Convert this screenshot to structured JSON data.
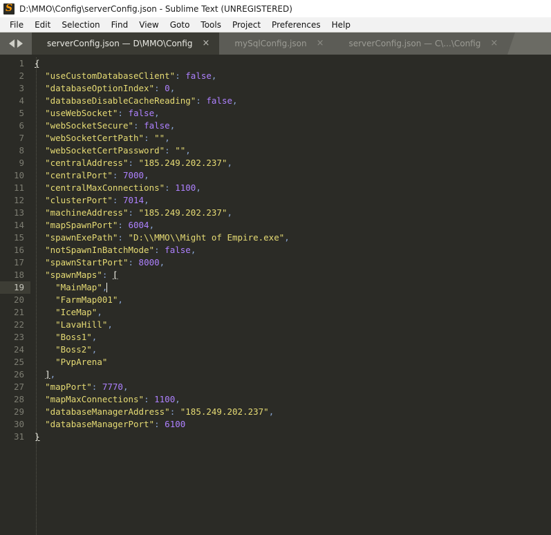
{
  "titlebar": {
    "icon": "sublime-logo-icon",
    "title": "D:\\MMO\\Config\\serverConfig.json - Sublime Text (UNREGISTERED)"
  },
  "menubar": {
    "items": [
      {
        "label": "File"
      },
      {
        "label": "Edit"
      },
      {
        "label": "Selection"
      },
      {
        "label": "Find"
      },
      {
        "label": "View"
      },
      {
        "label": "Goto"
      },
      {
        "label": "Tools"
      },
      {
        "label": "Project"
      },
      {
        "label": "Preferences"
      },
      {
        "label": "Help"
      }
    ]
  },
  "tabbar": {
    "nav_prev_icon": "arrow-left-icon",
    "nav_next_icon": "arrow-right-icon",
    "close_glyph": "×",
    "tabs": [
      {
        "label": "serverConfig.json — D\\MMO\\Config",
        "active": true,
        "unsaved": false
      },
      {
        "label": "mySqlConfig.json",
        "active": false,
        "unsaved": false
      },
      {
        "label": "serverConfig.json — C\\...\\Config",
        "active": false,
        "unsaved": false
      }
    ]
  },
  "editor": {
    "active_line": 19,
    "total_lines": 31,
    "colors": {
      "background": "#2b2b26",
      "gutter_text": "#7d7d72",
      "active_line": "#3d3d35",
      "string": "#e6db74",
      "number": "#ae81ff",
      "boolean": "#ae81ff",
      "punctuation": "#8ba7d6",
      "brace": "#e2e2d6"
    },
    "lines": [
      {
        "n": 1,
        "tokens": [
          {
            "t": "{",
            "c": "brm"
          }
        ]
      },
      {
        "n": 2,
        "tokens": [
          {
            "t": "  ",
            "c": ""
          },
          {
            "t": "\"useCustomDatabaseClient\"",
            "c": "k"
          },
          {
            "t": ":",
            "c": "p"
          },
          {
            "t": " ",
            "c": ""
          },
          {
            "t": "false",
            "c": "b"
          },
          {
            "t": ",",
            "c": "p"
          }
        ]
      },
      {
        "n": 3,
        "tokens": [
          {
            "t": "  ",
            "c": ""
          },
          {
            "t": "\"databaseOptionIndex\"",
            "c": "k"
          },
          {
            "t": ":",
            "c": "p"
          },
          {
            "t": " ",
            "c": ""
          },
          {
            "t": "0",
            "c": "n"
          },
          {
            "t": ",",
            "c": "p"
          }
        ]
      },
      {
        "n": 4,
        "tokens": [
          {
            "t": "  ",
            "c": ""
          },
          {
            "t": "\"databaseDisableCacheReading\"",
            "c": "k"
          },
          {
            "t": ":",
            "c": "p"
          },
          {
            "t": " ",
            "c": ""
          },
          {
            "t": "false",
            "c": "b"
          },
          {
            "t": ",",
            "c": "p"
          }
        ]
      },
      {
        "n": 5,
        "tokens": [
          {
            "t": "  ",
            "c": ""
          },
          {
            "t": "\"useWebSocket\"",
            "c": "k"
          },
          {
            "t": ":",
            "c": "p"
          },
          {
            "t": " ",
            "c": ""
          },
          {
            "t": "false",
            "c": "b"
          },
          {
            "t": ",",
            "c": "p"
          }
        ]
      },
      {
        "n": 6,
        "tokens": [
          {
            "t": "  ",
            "c": ""
          },
          {
            "t": "\"webSocketSecure\"",
            "c": "k"
          },
          {
            "t": ":",
            "c": "p"
          },
          {
            "t": " ",
            "c": ""
          },
          {
            "t": "false",
            "c": "b"
          },
          {
            "t": ",",
            "c": "p"
          }
        ]
      },
      {
        "n": 7,
        "tokens": [
          {
            "t": "  ",
            "c": ""
          },
          {
            "t": "\"webSocketCertPath\"",
            "c": "k"
          },
          {
            "t": ":",
            "c": "p"
          },
          {
            "t": " ",
            "c": ""
          },
          {
            "t": "\"\"",
            "c": "s"
          },
          {
            "t": ",",
            "c": "p"
          }
        ]
      },
      {
        "n": 8,
        "tokens": [
          {
            "t": "  ",
            "c": ""
          },
          {
            "t": "\"webSocketCertPassword\"",
            "c": "k"
          },
          {
            "t": ":",
            "c": "p"
          },
          {
            "t": " ",
            "c": ""
          },
          {
            "t": "\"\"",
            "c": "s"
          },
          {
            "t": ",",
            "c": "p"
          }
        ]
      },
      {
        "n": 9,
        "tokens": [
          {
            "t": "  ",
            "c": ""
          },
          {
            "t": "\"centralAddress\"",
            "c": "k"
          },
          {
            "t": ":",
            "c": "p"
          },
          {
            "t": " ",
            "c": ""
          },
          {
            "t": "\"185.249.202.237\"",
            "c": "s"
          },
          {
            "t": ",",
            "c": "p"
          }
        ]
      },
      {
        "n": 10,
        "tokens": [
          {
            "t": "  ",
            "c": ""
          },
          {
            "t": "\"centralPort\"",
            "c": "k"
          },
          {
            "t": ":",
            "c": "p"
          },
          {
            "t": " ",
            "c": ""
          },
          {
            "t": "7000",
            "c": "n"
          },
          {
            "t": ",",
            "c": "p"
          }
        ]
      },
      {
        "n": 11,
        "tokens": [
          {
            "t": "  ",
            "c": ""
          },
          {
            "t": "\"centralMaxConnections\"",
            "c": "k"
          },
          {
            "t": ":",
            "c": "p"
          },
          {
            "t": " ",
            "c": ""
          },
          {
            "t": "1100",
            "c": "n"
          },
          {
            "t": ",",
            "c": "p"
          }
        ]
      },
      {
        "n": 12,
        "tokens": [
          {
            "t": "  ",
            "c": ""
          },
          {
            "t": "\"clusterPort\"",
            "c": "k"
          },
          {
            "t": ":",
            "c": "p"
          },
          {
            "t": " ",
            "c": ""
          },
          {
            "t": "7014",
            "c": "n"
          },
          {
            "t": ",",
            "c": "p"
          }
        ]
      },
      {
        "n": 13,
        "tokens": [
          {
            "t": "  ",
            "c": ""
          },
          {
            "t": "\"machineAddress\"",
            "c": "k"
          },
          {
            "t": ":",
            "c": "p"
          },
          {
            "t": " ",
            "c": ""
          },
          {
            "t": "\"185.249.202.237\"",
            "c": "s"
          },
          {
            "t": ",",
            "c": "p"
          }
        ]
      },
      {
        "n": 14,
        "tokens": [
          {
            "t": "  ",
            "c": ""
          },
          {
            "t": "\"mapSpawnPort\"",
            "c": "k"
          },
          {
            "t": ":",
            "c": "p"
          },
          {
            "t": " ",
            "c": ""
          },
          {
            "t": "6004",
            "c": "n"
          },
          {
            "t": ",",
            "c": "p"
          }
        ]
      },
      {
        "n": 15,
        "tokens": [
          {
            "t": "  ",
            "c": ""
          },
          {
            "t": "\"spawnExePath\"",
            "c": "k"
          },
          {
            "t": ":",
            "c": "p"
          },
          {
            "t": " ",
            "c": ""
          },
          {
            "t": "\"D:\\\\MMO\\\\Might of Empire.exe\"",
            "c": "s"
          },
          {
            "t": ",",
            "c": "p"
          }
        ]
      },
      {
        "n": 16,
        "tokens": [
          {
            "t": "  ",
            "c": ""
          },
          {
            "t": "\"notSpawnInBatchMode\"",
            "c": "k"
          },
          {
            "t": ":",
            "c": "p"
          },
          {
            "t": " ",
            "c": ""
          },
          {
            "t": "false",
            "c": "b"
          },
          {
            "t": ",",
            "c": "p"
          }
        ]
      },
      {
        "n": 17,
        "tokens": [
          {
            "t": "  ",
            "c": ""
          },
          {
            "t": "\"spawnStartPort\"",
            "c": "k"
          },
          {
            "t": ":",
            "c": "p"
          },
          {
            "t": " ",
            "c": ""
          },
          {
            "t": "8000",
            "c": "n"
          },
          {
            "t": ",",
            "c": "p"
          }
        ]
      },
      {
        "n": 18,
        "tokens": [
          {
            "t": "  ",
            "c": ""
          },
          {
            "t": "\"spawnMaps\"",
            "c": "k"
          },
          {
            "t": ":",
            "c": "p"
          },
          {
            "t": " ",
            "c": ""
          },
          {
            "t": "[",
            "c": "brm"
          }
        ]
      },
      {
        "n": 19,
        "active": true,
        "tokens": [
          {
            "t": "    ",
            "c": ""
          },
          {
            "t": "\"MainMap\"",
            "c": "s"
          },
          {
            "t": ",",
            "c": "p"
          },
          {
            "t": "",
            "c": "caret"
          }
        ]
      },
      {
        "n": 20,
        "tokens": [
          {
            "t": "    ",
            "c": ""
          },
          {
            "t": "\"FarmMap001\"",
            "c": "s"
          },
          {
            "t": ",",
            "c": "p"
          }
        ]
      },
      {
        "n": 21,
        "tokens": [
          {
            "t": "    ",
            "c": ""
          },
          {
            "t": "\"IceMap\"",
            "c": "s"
          },
          {
            "t": ",",
            "c": "p"
          }
        ]
      },
      {
        "n": 22,
        "tokens": [
          {
            "t": "    ",
            "c": ""
          },
          {
            "t": "\"LavaHill\"",
            "c": "s"
          },
          {
            "t": ",",
            "c": "p"
          }
        ]
      },
      {
        "n": 23,
        "tokens": [
          {
            "t": "    ",
            "c": ""
          },
          {
            "t": "\"Boss1\"",
            "c": "s"
          },
          {
            "t": ",",
            "c": "p"
          }
        ]
      },
      {
        "n": 24,
        "tokens": [
          {
            "t": "    ",
            "c": ""
          },
          {
            "t": "\"Boss2\"",
            "c": "s"
          },
          {
            "t": ",",
            "c": "p"
          }
        ]
      },
      {
        "n": 25,
        "tokens": [
          {
            "t": "    ",
            "c": ""
          },
          {
            "t": "\"PvpArena\"",
            "c": "s"
          }
        ]
      },
      {
        "n": 26,
        "tokens": [
          {
            "t": "  ",
            "c": ""
          },
          {
            "t": "]",
            "c": "brm"
          },
          {
            "t": ",",
            "c": "p"
          }
        ]
      },
      {
        "n": 27,
        "tokens": [
          {
            "t": "  ",
            "c": ""
          },
          {
            "t": "\"mapPort\"",
            "c": "k"
          },
          {
            "t": ":",
            "c": "p"
          },
          {
            "t": " ",
            "c": ""
          },
          {
            "t": "7770",
            "c": "n"
          },
          {
            "t": ",",
            "c": "p"
          }
        ]
      },
      {
        "n": 28,
        "tokens": [
          {
            "t": "  ",
            "c": ""
          },
          {
            "t": "\"mapMaxConnections\"",
            "c": "k"
          },
          {
            "t": ":",
            "c": "p"
          },
          {
            "t": " ",
            "c": ""
          },
          {
            "t": "1100",
            "c": "n"
          },
          {
            "t": ",",
            "c": "p"
          }
        ]
      },
      {
        "n": 29,
        "tokens": [
          {
            "t": "  ",
            "c": ""
          },
          {
            "t": "\"databaseManagerAddress\"",
            "c": "k"
          },
          {
            "t": ":",
            "c": "p"
          },
          {
            "t": " ",
            "c": ""
          },
          {
            "t": "\"185.249.202.237\"",
            "c": "s"
          },
          {
            "t": ",",
            "c": "p"
          }
        ]
      },
      {
        "n": 30,
        "tokens": [
          {
            "t": "  ",
            "c": ""
          },
          {
            "t": "\"databaseManagerPort\"",
            "c": "k"
          },
          {
            "t": ":",
            "c": "p"
          },
          {
            "t": " ",
            "c": ""
          },
          {
            "t": "6100",
            "c": "n"
          }
        ]
      },
      {
        "n": 31,
        "tokens": [
          {
            "t": "}",
            "c": "brm"
          }
        ]
      }
    ]
  }
}
